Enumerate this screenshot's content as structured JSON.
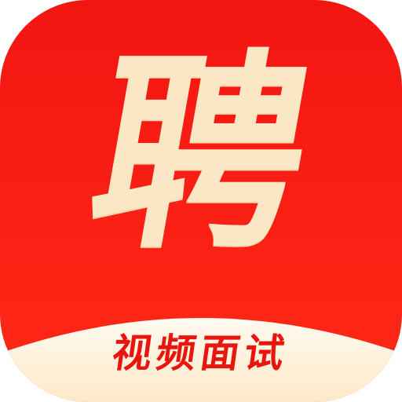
{
  "icon": {
    "main_char": "聘",
    "tagline": "视频面试"
  },
  "colors": {
    "background": "#f41511",
    "glyph": "#fbe7c6",
    "band": "#fff2dc",
    "tagline_text": "#e8160f"
  }
}
